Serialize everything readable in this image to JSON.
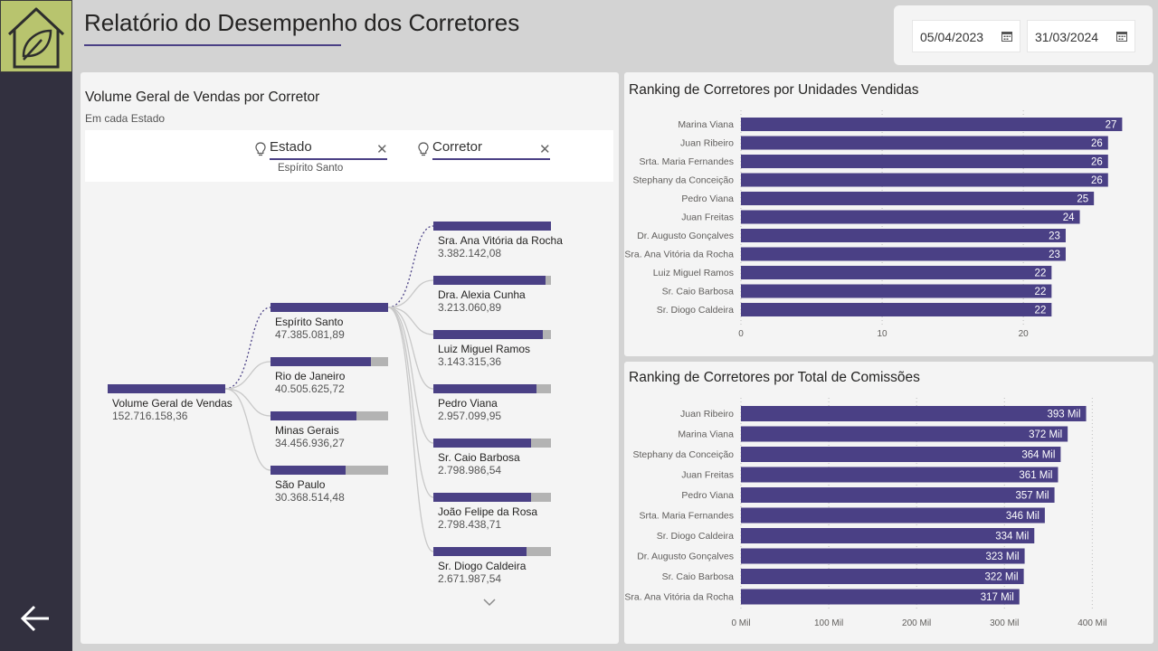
{
  "header": {
    "title": "Relatório do Desempenho dos Corretores",
    "start_date": "05/04/2023",
    "end_date": "31/03/2024"
  },
  "sidebar": {
    "logo_icon": "house-leaf-icon",
    "back_icon": "arrow-left-icon"
  },
  "colors": {
    "accent": "#4a4085",
    "sidebar": "#32303f",
    "logo": "#b8c46e",
    "remainder": "#b3b3b3"
  },
  "decomposition": {
    "title": "Volume Geral de Vendas por Corretor",
    "subtitle": "Em cada Estado",
    "filters": [
      {
        "label": "Estado",
        "value": "Espírito Santo"
      },
      {
        "label": "Corretor",
        "value": ""
      }
    ],
    "root": {
      "label": "Volume Geral de Vendas",
      "value": "152.716.158,36",
      "fill": 1.0
    },
    "states": [
      {
        "label": "Espírito Santo",
        "value": "47.385.081,89",
        "fill": 1.0
      },
      {
        "label": "Rio de Janeiro",
        "value": "40.505.625,72",
        "fill": 0.855
      },
      {
        "label": "Minas Gerais",
        "value": "34.456.936,27",
        "fill": 0.727
      },
      {
        "label": "São Paulo",
        "value": "30.368.514,48",
        "fill": 0.641
      }
    ],
    "brokers": [
      {
        "label": "Sra. Ana Vitória da Rocha",
        "value": "3.382.142,08",
        "fill": 1.0
      },
      {
        "label": "Dra. Alexia Cunha",
        "value": "3.213.060,89",
        "fill": 0.95
      },
      {
        "label": "Luiz Miguel Ramos",
        "value": "3.143.315,36",
        "fill": 0.929
      },
      {
        "label": "Pedro Viana",
        "value": "2.957.099,95",
        "fill": 0.874
      },
      {
        "label": "Sr. Caio Barbosa",
        "value": "2.798.986,54",
        "fill": 0.828
      },
      {
        "label": "João Felipe da Rosa",
        "value": "2.798.438,71",
        "fill": 0.827
      },
      {
        "label": "Sr. Diogo Caldeira",
        "value": "2.671.987,54",
        "fill": 0.79
      }
    ]
  },
  "chart_data": [
    {
      "type": "bar",
      "orientation": "horizontal",
      "title": "Ranking de Corretores por Unidades Vendidas",
      "categories": [
        "Marina Viana",
        "Juan Ribeiro",
        "Srta. Maria Fernandes",
        "Stephany da Conceição",
        "Pedro Viana",
        "Juan Freitas",
        "Dr. Augusto Gonçalves",
        "Sra. Ana Vitória da Rocha",
        "Luiz Miguel Ramos",
        "Sr. Caio Barbosa",
        "Sr. Diogo Caldeira"
      ],
      "values": [
        27,
        26,
        26,
        26,
        25,
        24,
        23,
        23,
        22,
        22,
        22
      ],
      "value_labels": [
        "27",
        "26",
        "26",
        "26",
        "25",
        "24",
        "23",
        "23",
        "22",
        "22",
        "22"
      ],
      "xlim": [
        0,
        28
      ],
      "ticks": [
        0,
        10,
        20
      ],
      "tick_labels": [
        "0",
        "10",
        "20"
      ],
      "grid": "vertical-dotted"
    },
    {
      "type": "bar",
      "orientation": "horizontal",
      "title": "Ranking de Corretores por Total de Comissões",
      "categories": [
        "Juan Ribeiro",
        "Marina Viana",
        "Stephany da Conceição",
        "Juan Freitas",
        "Pedro Viana",
        "Srta. Maria Fernandes",
        "Sr. Diogo Caldeira",
        "Dr. Augusto Gonçalves",
        "Sr. Caio Barbosa",
        "Sra. Ana Vitória da Rocha"
      ],
      "values": [
        393,
        372,
        364,
        361,
        357,
        346,
        334,
        323,
        322,
        317
      ],
      "value_labels": [
        "393 Mil",
        "372 Mil",
        "364 Mil",
        "361 Mil",
        "357 Mil",
        "346 Mil",
        "334 Mil",
        "323 Mil",
        "322 Mil",
        "317 Mil"
      ],
      "xlim": [
        0,
        412
      ],
      "ticks": [
        0,
        100,
        200,
        300,
        400
      ],
      "tick_labels": [
        "0 Mil",
        "100 Mil",
        "200 Mil",
        "300 Mil",
        "400 Mil"
      ],
      "grid": "vertical-dotted"
    }
  ]
}
